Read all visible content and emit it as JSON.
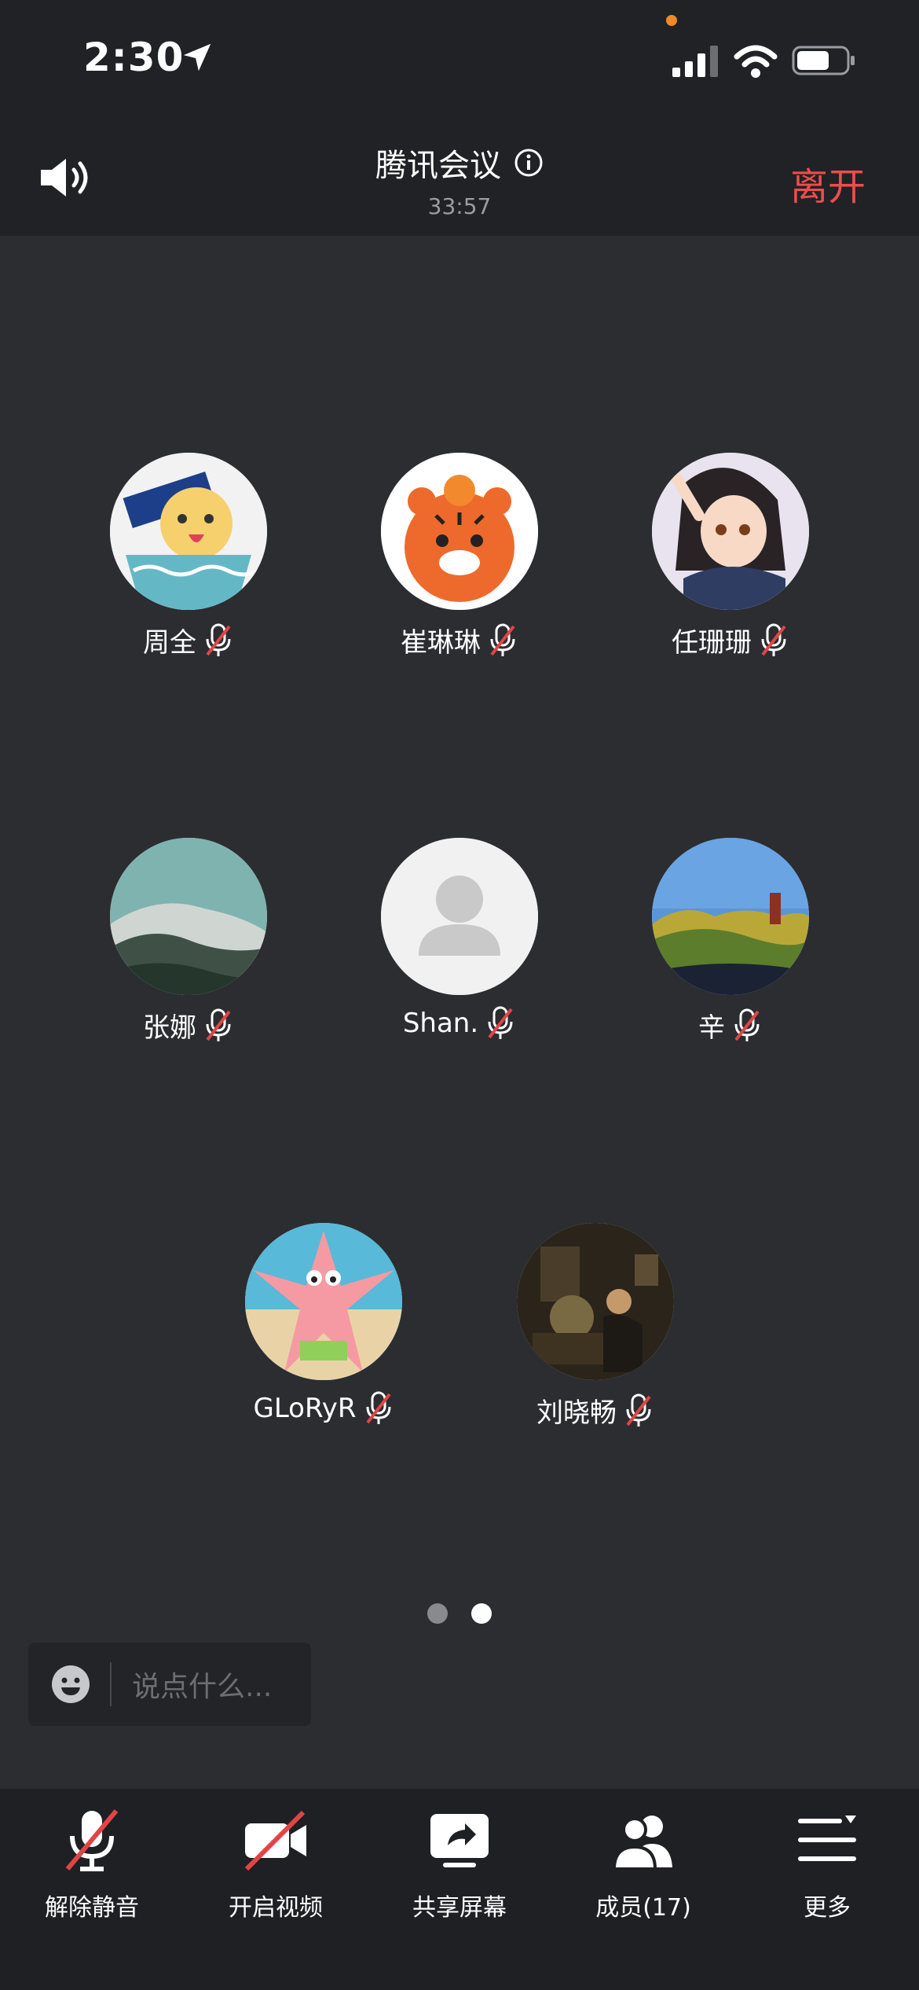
{
  "status_bar": {
    "time": "2:30"
  },
  "header": {
    "title": "腾讯会议",
    "timer": "33:57",
    "leave_label": "离开"
  },
  "participants": [
    {
      "name": "周全",
      "muted": true
    },
    {
      "name": "崔琳琳",
      "muted": true
    },
    {
      "name": "任珊珊",
      "muted": true
    },
    {
      "name": "张娜",
      "muted": true
    },
    {
      "name": "Shan.",
      "muted": true
    },
    {
      "name": "辛",
      "muted": true
    },
    {
      "name": "GLoRyR",
      "muted": true
    },
    {
      "name": "刘晓畅",
      "muted": true
    }
  ],
  "pagination": {
    "pages": 2,
    "current": 2
  },
  "chat": {
    "placeholder": "说点什么..."
  },
  "toolbar": {
    "unmute_label": "解除静音",
    "video_label": "开启视频",
    "share_label": "共享屏幕",
    "members_label": "成员(17)",
    "more_label": "更多"
  },
  "colors": {
    "leave": "#ee4d4d",
    "background": "#2b2d31",
    "muted_slash": "#e04545"
  }
}
